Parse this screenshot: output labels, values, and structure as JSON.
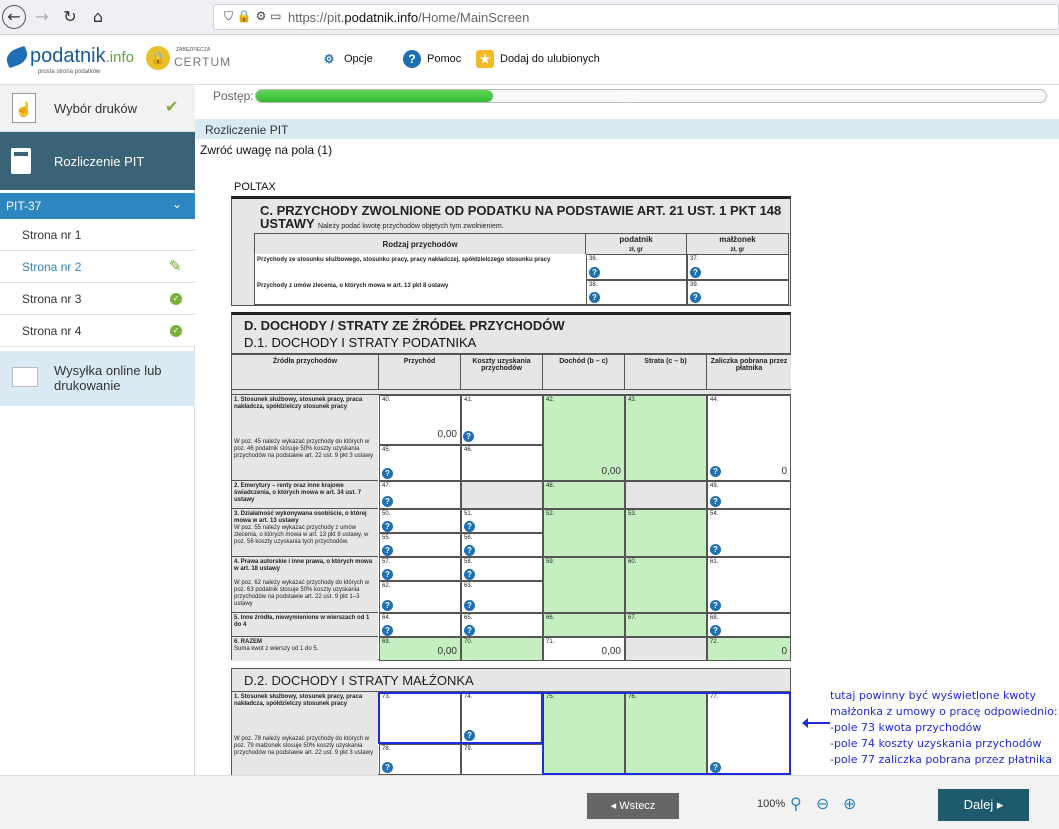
{
  "browser": {
    "url_prefix": "https://pit.",
    "url_domain": "podatnik.info",
    "url_path": "/Home/MainScreen"
  },
  "header": {
    "logo_main": "podatnik",
    "logo_suffix": ".info",
    "logo_sub": "prosta strona podatków",
    "certum_small": "ZABEZPIECZA",
    "certum": "CERTUM",
    "opcje": "Opcje",
    "pomoc": "Pomoc",
    "ulubione": "Dodaj do ulubionych"
  },
  "sidebar": {
    "wybor": "Wybór druków",
    "rozliczenie": "Rozliczenie PIT",
    "pit": "PIT-37",
    "pages": [
      "Strona nr 1",
      "Strona nr 2",
      "Strona nr 3",
      "Strona nr 4"
    ],
    "wysylka": "Wysyłka online lub drukowanie"
  },
  "progress": {
    "label": "Postęp:",
    "value": 0.3,
    "text": "30%"
  },
  "section_title": "Rozliczenie PIT",
  "attention": "Zwróć uwagę na pola (1)",
  "form": {
    "poltax": "POLTAX",
    "c_title": "C. PRZYCHODY ZWOLNIONE OD PODATKU NA PODSTAWIE ART. 21 UST. 1 PKT 148 USTAWY",
    "c_note": "Należy podać kwotę przychodów objętych tym zwolnieniem.",
    "c_h_rodzaj": "Rodzaj przychodów",
    "c_h_podatnik": "podatnik",
    "c_h_malzonek": "małżonek",
    "c_zl": "zł, gr",
    "c_row1": "Przychody ze stosunku służbowego, stosunku pracy, pracy nakładczej, spółdzielczego stosunku pracy",
    "c_row2": "Przychody z umów zlecenia, o których mowa w art. 13 pkt 8 ustawy",
    "d_title": "D. DOCHODY / STRATY ZE ŹRÓDEŁ PRZYCHODÓW",
    "d1_title": "D.1. DOCHODY I STRATY PODATNIKA",
    "d_cols": [
      "Źródła przychodów",
      "Przychód",
      "Koszty uzyskania przychodów",
      "Dochód (b – c)",
      "Strata (c – b)",
      "Zaliczka pobrana przez płatnika"
    ],
    "letters": [
      "a",
      "b",
      "c",
      "d",
      "e",
      "f"
    ],
    "r1": "1. Stosunek służbowy, stosunek pracy, praca nakładcza, spółdzielczy stosunek pracy",
    "r1_note": "W poz. 45 należy wykazać przychody do których w poz. 46 podatnik stosuje 50% koszty uzyskania przychodów na podstawie art. 22 ust. 9 pkt 3 ustawy",
    "r2": "2. Emerytury – renty oraz inne krajowe świadczenia, o których mowa w art. 34 ust. 7 ustawy",
    "r3": "3. Działalność wykonywana osobiście, o której mowa w art. 13 ustawy",
    "r3_note": "W poz. 55 należy wykazać przychody z umów zlecenia, o których mowa w art. 13 pkt 8 ustawy, w poz. 56 koszty uzyskania tych przychodów.",
    "r4": "4. Prawa autorskie i inne prawa, o których mowa w art. 18 ustawy",
    "r4_note": "W poz. 62 należy wykazać przychody do których w poz. 63 podatnik stosuje 50% koszty uzyskania przychodów na podstawie art. 22 ust. 9 pkt 1–3 ustawy",
    "r5": "5. Inne źródła, niewymienione w wierszach od 1 do 4",
    "r6": "6. RAZEM",
    "r6_note": "Suma kwot z wierszy od 1 do 5.",
    "v40": "0,00",
    "v42": "0,00",
    "v44": "0",
    "v69": "0,00",
    "v71": "0,00",
    "v72": "0",
    "d2_title": "D.2. DOCHODY I STRATY MAŁŻONKA",
    "r7": "1. Stosunek służbowy, stosunek pracy, praca nakładcza, spółdzielczy stosunek pracy",
    "r7_note": "W poz. 78 należy wykazać przychody do których w poz. 79 małżonek stosuje 50% koszty uzyskania przychodów na podstawie art. 22 ust. 9 pkt 3 ustawy"
  },
  "note": {
    "line1": "tutaj powinny być wyświetlone kwoty",
    "line2": "małżonka z umowy o pracę odpowiednio:",
    "line3": "-pole 73 kwota przychodów",
    "line4": "-pole 74 koszty uzyskania przychodów",
    "line5": "-pole 77 zaliczka pobrana przez płatnika"
  },
  "footer": {
    "back": "Wstecz",
    "zoom": "100%",
    "next": "Dalej"
  },
  "colors": {
    "accent": "#2e86c1",
    "sidebar_active": "#3a6377",
    "green_field": "#c6efc1",
    "annotation": "#1e2ce0",
    "next_button": "#1d5a6e"
  }
}
